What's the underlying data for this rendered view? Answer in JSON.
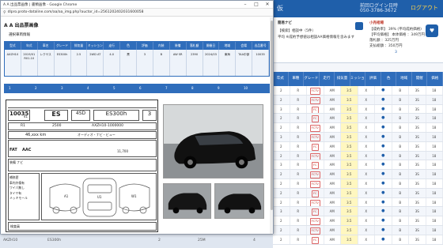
{
  "background_app": {
    "header_count": "仮",
    "login_label": "前回ログイン日時",
    "phone": "050-3786-3672",
    "logout_link": "ログアウト",
    "info_label": "簡易ナビ",
    "info_line1": "【検索】相談中（5件）",
    "info_line2": "平均 ※成約予想値は相談AA価格情報を含みます",
    "right_title": "小売相場",
    "right_line1": "【成約率】 39% (平均成約価格)",
    "right_line2": "【平均価格】 本体価格 ：349万円",
    "right_line3": "落札額 ：325万円",
    "right_line4": "支払総額 ：350万円",
    "right_number": "3",
    "columns": [
      "年式",
      "車種",
      "グレード",
      "走行",
      "排気量",
      "ミッション",
      "評価",
      "色",
      "地域",
      "開催",
      "価格"
    ],
    "rows": [
      [
        "2",
        "R",
        "FCTV",
        "AM",
        "3.5",
        "X",
        "●",
        "B",
        "3S",
        "18"
      ],
      [
        "2",
        "R",
        "FCTV",
        "AM",
        "3.5",
        "X",
        "●",
        "B",
        "3S",
        "18"
      ],
      [
        "3",
        "R",
        "FC",
        "AM",
        "3.5",
        "X",
        "●",
        "B",
        "3S",
        "18"
      ],
      [
        "2",
        "R",
        "FC",
        "AM",
        "3.5",
        "X",
        "●",
        "B",
        "3S",
        "18"
      ],
      [
        "2",
        "R",
        "FCTV",
        "AM",
        "3.5",
        "X",
        "●",
        "B",
        "3S",
        "18"
      ],
      [
        "3",
        "R",
        "FCTV",
        "AM",
        "3.5",
        "X",
        "●",
        "B",
        "3S",
        "18"
      ],
      [
        "2",
        "R",
        "FC",
        "AM",
        "3.5",
        "X",
        "●",
        "B",
        "3S",
        "18"
      ],
      [
        "2",
        "R",
        "FCTV",
        "AM",
        "3.5",
        "X",
        "●",
        "B",
        "3S",
        "18"
      ],
      [
        "3",
        "R",
        "FC",
        "AM",
        "3.5",
        "X",
        "●",
        "B",
        "3S",
        "18"
      ],
      [
        "2",
        "R",
        "FCTV",
        "AM",
        "3.5",
        "X",
        "●",
        "B",
        "3S",
        "18"
      ],
      [
        "2",
        "R",
        "FCTV",
        "AM",
        "3.5",
        "X",
        "●",
        "B",
        "3S",
        "18"
      ],
      [
        "2",
        "R",
        "FC",
        "AM",
        "3.5",
        "X",
        "●",
        "B",
        "3S",
        "18"
      ],
      [
        "2",
        "R",
        "FCTV",
        "AM",
        "3.5",
        "X",
        "●",
        "B",
        "3S",
        "18"
      ],
      [
        "3",
        "R",
        "FC",
        "AM",
        "3.5",
        "X",
        "●",
        "B",
        "3S",
        "18"
      ],
      [
        "2",
        "R",
        "FCTV",
        "AM",
        "3.5",
        "X",
        "●",
        "B",
        "3S",
        "18"
      ],
      [
        "2",
        "R",
        "FCTV",
        "AM",
        "3.5",
        "X",
        "●",
        "B",
        "3S",
        "18"
      ],
      [
        "2",
        "R",
        "FC",
        "AM",
        "3.5",
        "X",
        "●",
        "B",
        "3S",
        "18"
      ]
    ],
    "bottom_left_code": "AKZH10",
    "bottom_left_grade": "ES300h",
    "bottom_left_score": "2",
    "bottom_left_ym": "25M",
    "bottom_left_num": "4"
  },
  "popup": {
    "window_title": "A A 出品票画像 | 書類画像 - Google Chrome",
    "url": "dlpro.proto-dataline.com/aa/aa_img.php?auctor_id=2561202402031600058",
    "doc_title": "A A 出品票画像",
    "doc_subtitle": "選択車両情報",
    "info_columns": [
      "型式",
      "年式",
      "車名",
      "グレード",
      "排気量",
      "ミッション",
      "走行",
      "色",
      "評価",
      "内装",
      "装備",
      "落札額",
      "開催日",
      "地域",
      "会場",
      "出品番号"
    ],
    "info_values": [
      "AXZH10",
      "2019/01 R01.10",
      "レクサス",
      "ES300h",
      "2.5",
      "2WD AT",
      "4.0",
      "黒",
      "3",
      "B",
      "AW SR",
      "2390",
      "2024/03",
      "東海",
      "TAA中部",
      "10035"
    ],
    "tabs": [
      "1",
      "2",
      "3",
      "4",
      "5",
      "6",
      "7",
      "8",
      "9",
      "10"
    ],
    "sheet": {
      "lot": "10035",
      "lot_sub": "41",
      "grade": "ES",
      "body": "4SD",
      "model": "ES300h",
      "model_count": "3",
      "year": "R1",
      "cc": "2500",
      "frame": "AXZH10-1000000",
      "mileage": "46,xxx km",
      "options": "オーディオ・ナビ・ビュー",
      "fat": "FAT",
      "aac": "AAC",
      "price": "11,700",
      "notes": "装備 ナビ",
      "left_notes": "補修歴\n車内外傷有\nワイパ無し\nタイヤ有\nメッキモール",
      "footer": "検査員"
    }
  }
}
